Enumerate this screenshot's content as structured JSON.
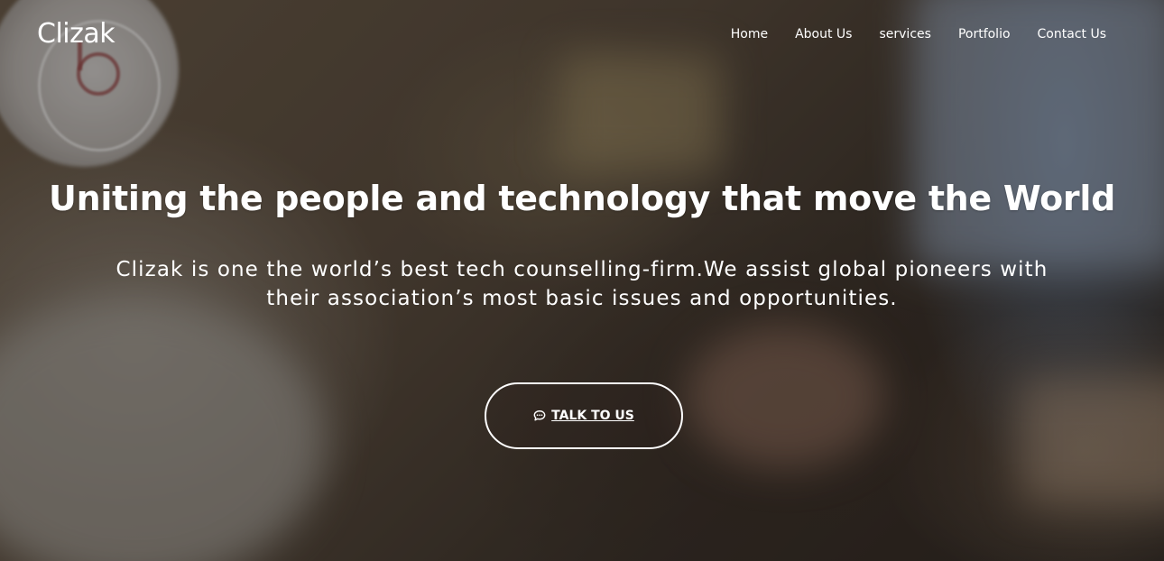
{
  "nav": {
    "brand": "Clizak",
    "items": [
      {
        "label": "Home"
      },
      {
        "label": "About Us"
      },
      {
        "label": "services"
      },
      {
        "label": "Portfolio"
      },
      {
        "label": "Contact Us"
      }
    ]
  },
  "hero": {
    "headline": "Uniting the people and technology that move the World",
    "subtext": "Clizak is one the world’s best tech counselling-firm.We assist global pioneers with their association’s most basic issues and opportunities.",
    "cta_label": "TALK TO US",
    "cta_icon": "comment-icon"
  },
  "colors": {
    "text": "#ffffff",
    "overlay": "rgba(0,0,0,0.30)"
  }
}
